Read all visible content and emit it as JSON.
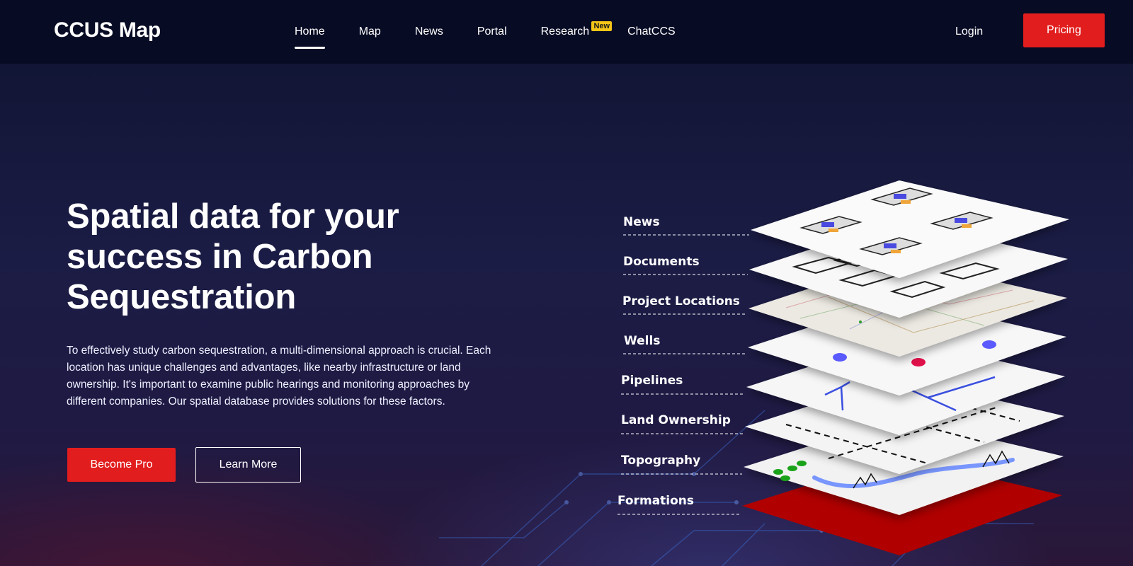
{
  "header": {
    "logo": "CCUS Map",
    "nav": [
      {
        "label": "Home",
        "active": true
      },
      {
        "label": "Map",
        "active": false
      },
      {
        "label": "News",
        "active": false
      },
      {
        "label": "Portal",
        "active": false
      },
      {
        "label": "Research",
        "active": false,
        "badge": "New"
      },
      {
        "label": "ChatCCS",
        "active": false
      }
    ],
    "login_label": "Login",
    "pricing_label": "Pricing"
  },
  "hero": {
    "title": "Spatial data for your success in Carbon Sequestration",
    "description": "To effectively study carbon sequestration, a multi-dimensional approach is crucial. Each location has unique challenges and advantages, like nearby infrastructure or land ownership. It's important to examine public hearings and monitoring approaches by different companies. Our spatial database provides solutions for these factors.",
    "primary_button": "Become Pro",
    "secondary_button": "Learn More"
  },
  "layers": {
    "labels": [
      "News",
      "Documents",
      "Project Locations",
      "Wells",
      "Pipelines",
      "Land Ownership",
      "Topography",
      "Formations"
    ]
  },
  "colors": {
    "accent_red": "#e21d1d",
    "header_bg": "#070b24",
    "badge_yellow": "#f5c518",
    "formation_red": "#b00000"
  }
}
